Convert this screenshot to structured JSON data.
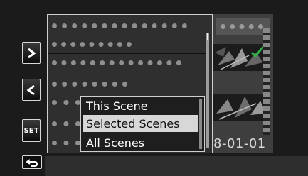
{
  "date_display": "8-01-01",
  "buttons": {
    "next_icon": "chevron-right-icon",
    "prev_icon": "chevron-left-icon",
    "set_label": "SET",
    "return_icon": "return-arrow-icon"
  },
  "popup_menu": {
    "items": [
      {
        "label": "This Scene",
        "selected": false
      },
      {
        "label": "Selected Scenes",
        "selected": true
      },
      {
        "label": "All Scenes",
        "selected": false
      }
    ]
  },
  "colors": {
    "checkmark": "#2fb24a",
    "selection_highlight": "#d7d7d7"
  }
}
